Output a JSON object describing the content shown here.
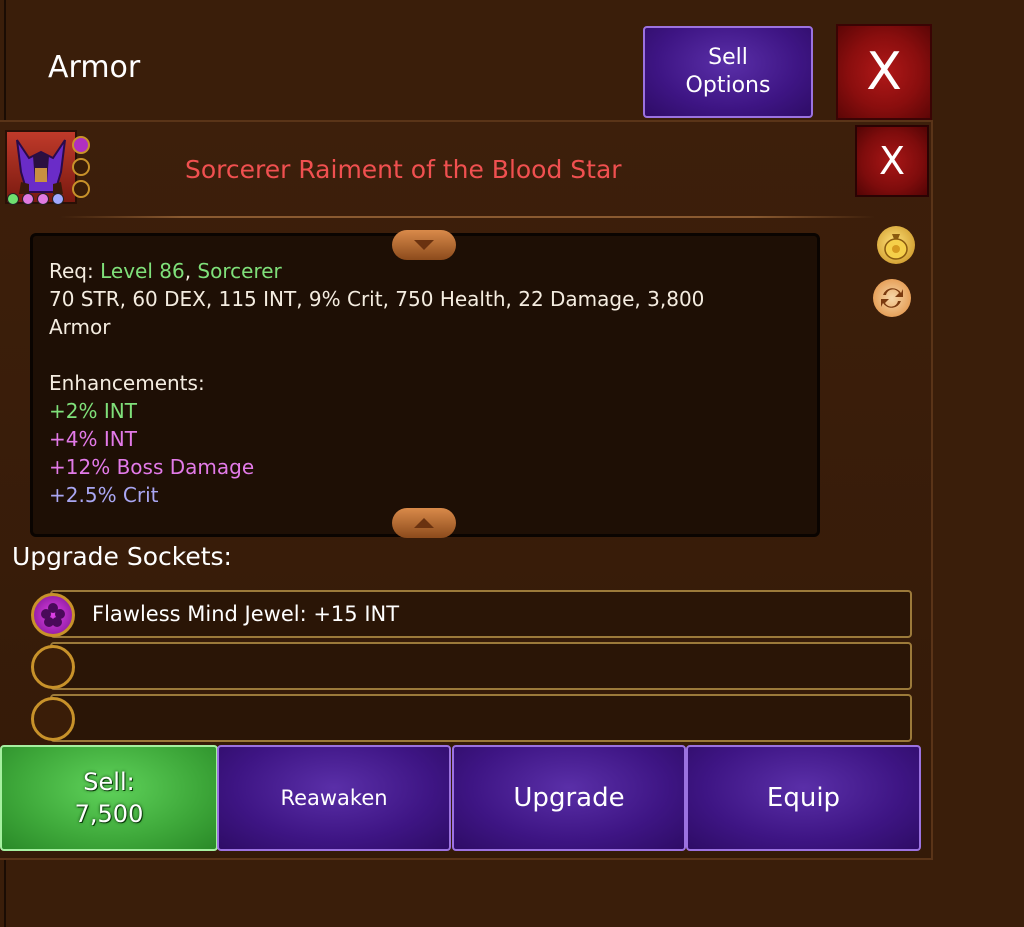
{
  "header": {
    "title": "Armor",
    "sell_options_label": "Sell\nOptions",
    "close_label": "X"
  },
  "item": {
    "name": "Sorcerer Raiment of the Blood Star",
    "close_label": "X",
    "req_prefix": "Req: ",
    "req_level": "Level 86",
    "req_sep": ", ",
    "req_class": "Sorcerer",
    "stats_line1": "70 STR, 60 DEX, 115 INT, 9% Crit, 750 Health, 22 Damage, 3,800",
    "stats_line2": "Armor",
    "enhancements_title": "Enhancements:",
    "enhancements": [
      {
        "text": "+2% INT",
        "color": "#7fe07a"
      },
      {
        "text": "+4% INT",
        "color": "#e27ae8"
      },
      {
        "text": "+12% Boss Damage",
        "color": "#e27ae8"
      },
      {
        "text": "+2.5% Crit",
        "color": "#a9a6f2"
      }
    ],
    "gem_dot_colors": [
      "#6fe06f",
      "#e07ae0",
      "#e07ae0",
      "#a0a8ff"
    ]
  },
  "sockets": {
    "title": "Upgrade Sockets:",
    "slots": [
      {
        "text": "Flawless Mind Jewel: +15 INT",
        "filled": true
      },
      {
        "text": "",
        "filled": false
      },
      {
        "text": "",
        "filled": false
      }
    ]
  },
  "actions": {
    "sell_label": "Sell:",
    "sell_price": "7,500",
    "reawaken_label": "Reawaken",
    "upgrade_label": "Upgrade",
    "equip_label": "Equip"
  },
  "icons": [
    "coin-bag-icon",
    "swap-icon",
    "close-icon",
    "scroll-up-icon",
    "scroll-down-icon",
    "jewel-icon"
  ]
}
